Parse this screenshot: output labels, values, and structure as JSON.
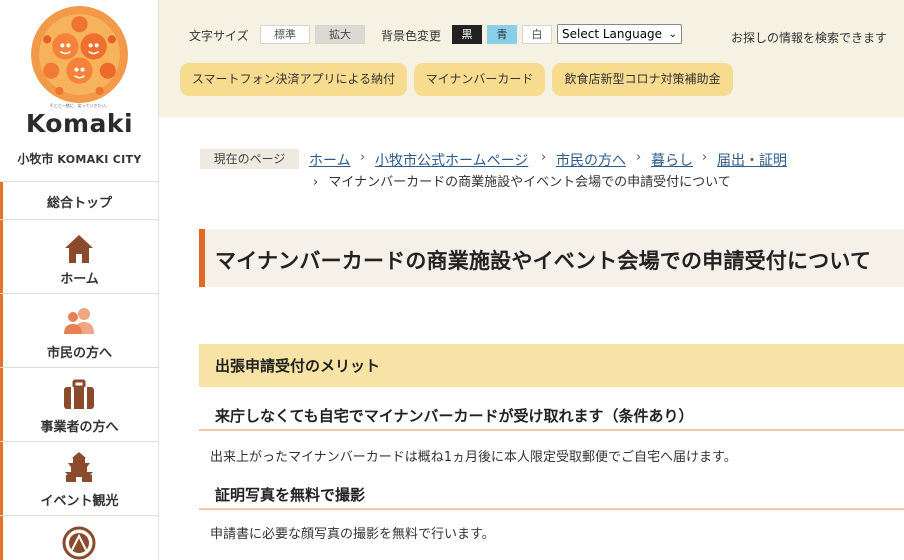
{
  "sidebar": {
    "logo_brand": "Komaki",
    "logo_tagline": "そとと一緒に、笑っていきたい。",
    "city_ja": "小牧市",
    "city_en": "KOMAKI CITY",
    "items": [
      {
        "label": "総合トップ",
        "icon": "none"
      },
      {
        "label": "ホーム",
        "icon": "home-icon"
      },
      {
        "label": "市民の方へ",
        "icon": "people-icon"
      },
      {
        "label": "事業者の方へ",
        "icon": "briefcase-icon"
      },
      {
        "label": "イベント観光",
        "icon": "castle-icon"
      },
      {
        "label": "",
        "icon": "emblem-icon"
      }
    ],
    "accent_color": "#e2742c"
  },
  "header": {
    "font_size_label": "文字サイズ",
    "font_standard": "標準",
    "font_large": "拡大",
    "bg_label": "背景色変更",
    "bg_black": "黒",
    "bg_blue": "青",
    "bg_white": "白",
    "language_select": "Select Language",
    "search_text": "お探しの情報を検索できます",
    "pills": [
      "スマートフォン決済アプリによる納付",
      "マイナンバーカード",
      "飲食店新型コロナ対策補助金"
    ]
  },
  "breadcrumb": {
    "current_label": "現在のページ",
    "links": [
      "ホーム",
      "小牧市公式ホームページ",
      "市民の方へ",
      "暮らし",
      "届出・証明"
    ],
    "separator": "›",
    "last": "マイナンバーカードの商業施設やイベント会場での申請受付について"
  },
  "main": {
    "title": "マイナンバーカードの商業施設やイベント会場での申請受付について",
    "section_heading": "出張申請受付のメリット",
    "benefits": [
      {
        "heading": "来庁しなくても自宅でマイナンバーカードが受け取れます（条件あり）",
        "text": "出来上がったマイナンバーカードは概ね1ヵ月後に本人限定受取郵便でご自宅へ届けます。"
      },
      {
        "heading": "証明写真を無料で撮影",
        "text": "申請書に必要な顔写真の撮影を無料で行います。"
      }
    ]
  },
  "colors": {
    "header_bg": "#f5f1e3",
    "pill_bg": "#f7dc90",
    "title_accent": "#e06a25",
    "section_bg": "#f7e3a5",
    "link": "#2d5c8c"
  }
}
